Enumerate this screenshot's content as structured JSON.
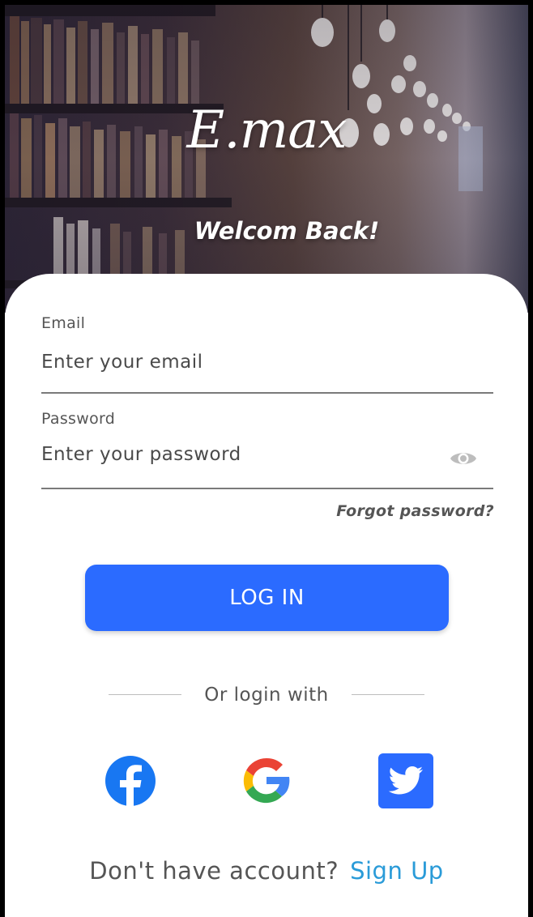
{
  "hero": {
    "logo_text": "E.max",
    "welcome_text": "Welcom Back!"
  },
  "form": {
    "email": {
      "label": "Email",
      "placeholder": "Enter your email",
      "value": ""
    },
    "password": {
      "label": "Password",
      "placeholder": "Enter your password",
      "value": "",
      "visibility_icon": "eye-icon"
    },
    "forgot_label": "Forgot password?",
    "login_label": "LOG IN"
  },
  "social": {
    "divider_text": "Or login with",
    "providers": [
      {
        "name": "Facebook",
        "icon": "facebook-icon",
        "color": "#1877f2"
      },
      {
        "name": "Google",
        "icon": "google-icon",
        "color": "#4285f4"
      },
      {
        "name": "Twitter",
        "icon": "twitter-icon",
        "color": "#2b6bff"
      }
    ]
  },
  "signup": {
    "prompt": "Don't have account?",
    "link_label": "Sign Up"
  },
  "colors": {
    "primary": "#2b6bff",
    "link": "#2a9bd8",
    "text": "#555555"
  }
}
